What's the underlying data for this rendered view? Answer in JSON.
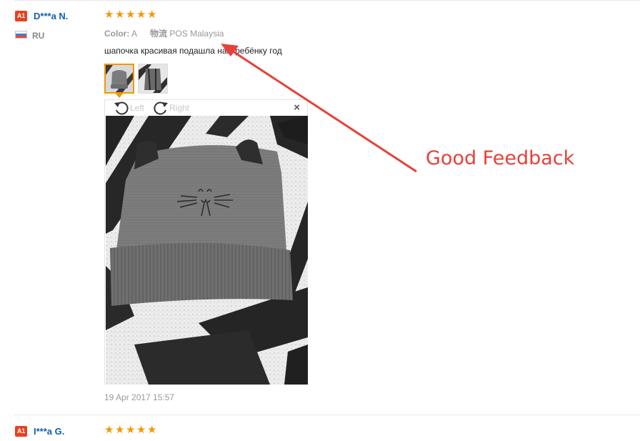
{
  "reviews": [
    {
      "level_badge": "A1",
      "username": "D***a N.",
      "country": "RU",
      "rating": 5,
      "color_label": "Color:",
      "color_value": "A",
      "shipping_label": "物流",
      "shipping_value": "POS Malaysia",
      "text": "шапочка красивая подашла нам ребёнку год",
      "image_viewer": {
        "rotate_left_label": "Left",
        "rotate_right_label": "Right",
        "close_symbol": "×"
      },
      "date": "19 Apr 2017 15:57"
    },
    {
      "level_badge": "A1",
      "username": "I***a G.",
      "rating": 5
    }
  ],
  "annotation": {
    "text": "Good Feedback",
    "color": "#e8403a"
  },
  "colors": {
    "badge": "#e8401f",
    "username": "#0d60b5",
    "star": "#f39800"
  },
  "icons": {
    "star": "star-icon",
    "rotate_left": "rotate-left-icon",
    "rotate_right": "rotate-right-icon",
    "close": "close-icon",
    "flag": "russia-flag-icon"
  }
}
